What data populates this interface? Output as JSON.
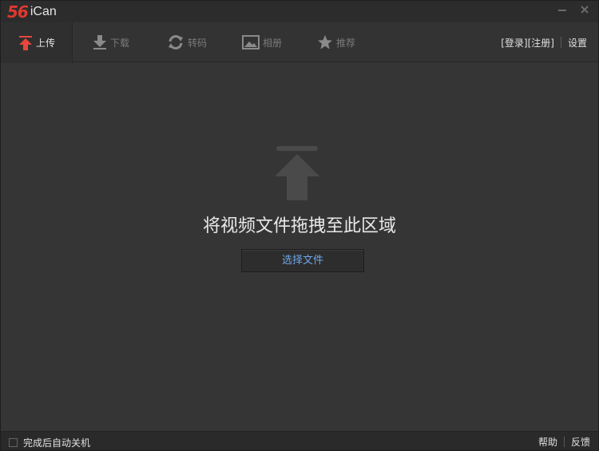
{
  "titlebar": {
    "brand": "56",
    "app_name": "iCan",
    "icons": {
      "minimize": "minimize-icon",
      "close": "close-icon"
    }
  },
  "toolbar": {
    "tabs": [
      {
        "label": "上传",
        "icon": "upload-icon",
        "active": true
      },
      {
        "label": "下载",
        "icon": "download-icon",
        "active": false
      },
      {
        "label": "转码",
        "icon": "refresh-icon",
        "active": false
      },
      {
        "label": "相册",
        "icon": "image-icon",
        "active": false
      },
      {
        "label": "推荐",
        "icon": "star-icon",
        "active": false
      }
    ],
    "login": "[登录]",
    "register": "[注册]",
    "settings": "设置"
  },
  "main": {
    "drop_text": "将视频文件拖拽至此区域",
    "select_button": "选择文件"
  },
  "statusbar": {
    "auto_shutdown": "完成后自动关机",
    "help": "帮助",
    "feedback": "反馈"
  },
  "colors": {
    "brand_red": "#e0392f",
    "active_icon_red": "#e8463c",
    "link_blue": "#6ea6e8",
    "background": "#353535"
  }
}
